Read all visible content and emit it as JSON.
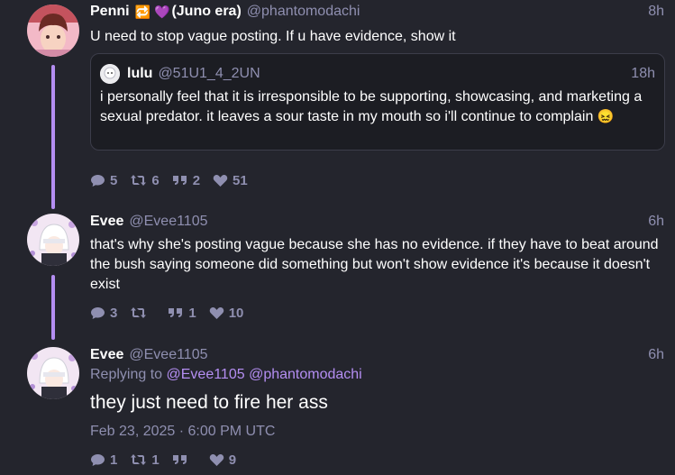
{
  "posts": [
    {
      "name": "Penni",
      "name_emoji_1": "🔁",
      "name_emoji_2": "💜",
      "name_suffix": "(Juno era)",
      "handle": "@phantomodachi",
      "time": "8h",
      "text": "U need to stop vague posting. If u have evidence, show it",
      "quote": {
        "name": "lulu",
        "handle": "@51U1_4_2UN",
        "time": "18h",
        "text": "i personally feel that it is irresponsible to be supporting, showcasing, and marketing a sexual predator. it leaves a sour taste in my mouth so i'll continue to complain",
        "emoji": "😖"
      },
      "counts": {
        "replies": "5",
        "reposts": "6",
        "quotes": "2",
        "likes": "51"
      }
    },
    {
      "name": "Evee",
      "handle": "@Evee1105",
      "time": "6h",
      "text": "that's why she's posting vague because she has no evidence. if they have to beat around the bush saying someone did something but won't show evidence it's because it doesn't exist",
      "counts": {
        "replies": "3",
        "reposts": "",
        "quotes": "1",
        "likes": "10"
      }
    },
    {
      "name": "Evee",
      "handle": "@Evee1105",
      "time": "6h",
      "replying_prefix": "Replying to",
      "replying_1": "@Evee1105",
      "replying_2": "@phantomodachi",
      "text": "they just need to fire her ass",
      "date": "Feb 23, 2025 · 6:00 PM UTC",
      "counts": {
        "replies": "1",
        "reposts": "1",
        "quotes": "",
        "likes": "9"
      }
    }
  ],
  "colors": {
    "background": "#24252d",
    "accent": "#b48ef2",
    "muted": "#8f8fb0"
  }
}
